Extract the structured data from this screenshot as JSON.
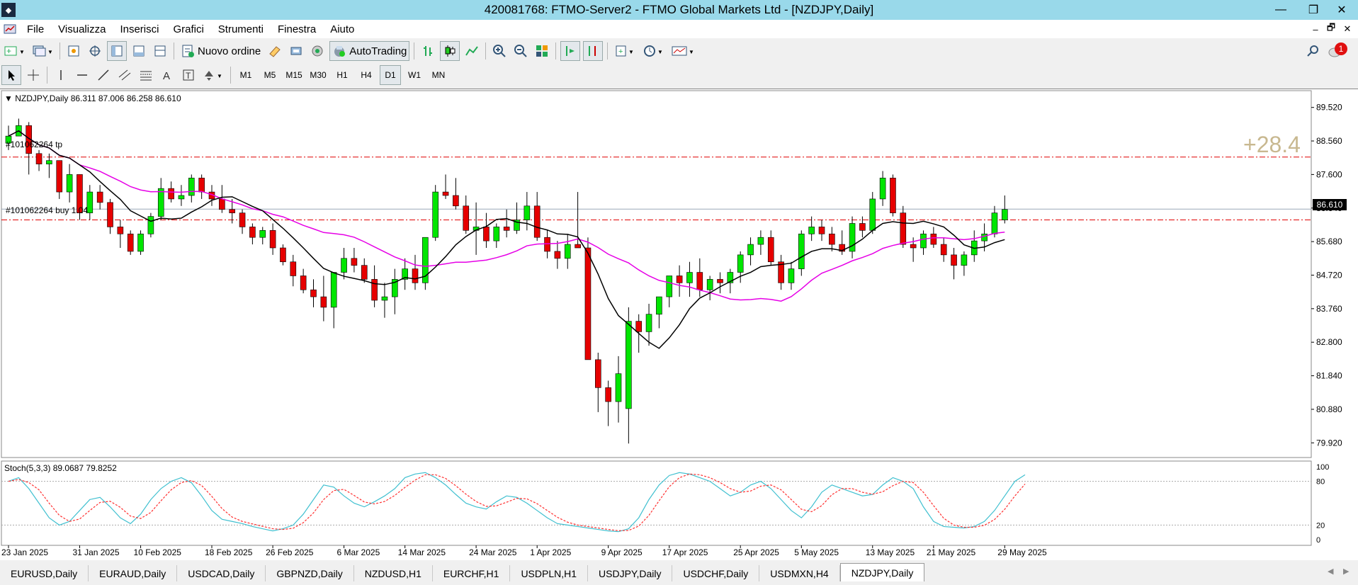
{
  "window": {
    "title": "420081768: FTMO-Server2 - FTMO Global Markets Ltd - [NZDJPY,Daily]",
    "app_icon": "◆",
    "minimize": "—",
    "restore": "❐",
    "close": "✕"
  },
  "menu": [
    "File",
    "Visualizza",
    "Inserisci",
    "Grafici",
    "Strumenti",
    "Finestra",
    "Aiuto"
  ],
  "mdi": {
    "minimize": "–",
    "restore": "🗗",
    "close": "✕"
  },
  "toolbar": {
    "new_order": "Nuovo ordine",
    "autotrading": "AutoTrading",
    "notification_count": "1"
  },
  "timeframes": [
    "M1",
    "M5",
    "M15",
    "M30",
    "H1",
    "H4",
    "D1",
    "W1",
    "MN"
  ],
  "active_timeframe": "D1",
  "chart": {
    "header": "NZDJPY,Daily  86.311 87.006 86.258 86.610",
    "stoch_header": "Stoch(5,3,3) 89.0687 79.8252",
    "tp_label": "#101062264 tp",
    "buy_label": "#101062264 buy 1.04",
    "profit": "+28.4",
    "current_price": "86.610",
    "price_levels": [
      "89.520",
      "88.560",
      "87.600",
      "86.640",
      "85.680",
      "84.720",
      "83.760",
      "82.800",
      "81.840",
      "80.880",
      "79.920"
    ],
    "stoch_levels": [
      "100",
      "80",
      "20",
      "0"
    ],
    "dates": [
      "23 Jan 2025",
      "31 Jan 2025",
      "10 Feb 2025",
      "18 Feb 2025",
      "26 Feb 2025",
      "6 Mar 2025",
      "14 Mar 2025",
      "24 Mar 2025",
      "1 Apr 2025",
      "9 Apr 2025",
      "17 Apr 2025",
      "25 Apr 2025",
      "5 May 2025",
      "13 May 2025",
      "21 May 2025",
      "29 May 2025"
    ],
    "colors": {
      "bull": "#00e600",
      "bear": "#e60000",
      "ma_fast": "#000000",
      "ma_slow": "#e600e6",
      "stoch_main": "#40c0d0",
      "stoch_signal": "#ff3030",
      "profit": "#c8b890"
    }
  },
  "chart_data": {
    "type": "candlestick",
    "symbol": "NZDJPY",
    "timeframe": "Daily",
    "ylim": [
      79.5,
      90.0
    ],
    "tp_price": 88.1,
    "entry_price": 86.3,
    "current_price": 86.61,
    "candles": [
      [
        88.5,
        89.0,
        88.3,
        88.7
      ],
      [
        88.7,
        89.2,
        88.8,
        89.0
      ],
      [
        89.0,
        89.1,
        87.6,
        88.2
      ],
      [
        88.2,
        88.3,
        87.7,
        87.9
      ],
      [
        87.9,
        88.2,
        87.5,
        88.0
      ],
      [
        88.0,
        88.0,
        86.9,
        87.1
      ],
      [
        87.1,
        87.9,
        86.8,
        87.6
      ],
      [
        87.6,
        87.6,
        86.3,
        86.5
      ],
      [
        86.5,
        87.3,
        86.3,
        87.1
      ],
      [
        87.1,
        87.3,
        86.6,
        86.8
      ],
      [
        86.8,
        86.9,
        85.9,
        86.1
      ],
      [
        86.1,
        86.3,
        85.5,
        85.9
      ],
      [
        85.9,
        86.0,
        85.3,
        85.4
      ],
      [
        85.4,
        86.0,
        85.3,
        85.9
      ],
      [
        85.9,
        86.5,
        85.8,
        86.4
      ],
      [
        86.4,
        87.5,
        86.3,
        87.2
      ],
      [
        87.2,
        87.4,
        86.8,
        86.9
      ],
      [
        86.9,
        87.3,
        86.7,
        87.0
      ],
      [
        87.0,
        87.6,
        86.8,
        87.5
      ],
      [
        87.5,
        87.6,
        86.9,
        87.1
      ],
      [
        87.1,
        87.3,
        86.7,
        86.9
      ],
      [
        86.9,
        87.3,
        86.5,
        86.6
      ],
      [
        86.6,
        86.9,
        86.2,
        86.5
      ],
      [
        86.5,
        86.6,
        85.9,
        86.1
      ],
      [
        86.1,
        86.2,
        85.6,
        85.8
      ],
      [
        85.8,
        86.1,
        85.6,
        86.0
      ],
      [
        86.0,
        86.2,
        85.3,
        85.5
      ],
      [
        85.5,
        85.6,
        85.0,
        85.1
      ],
      [
        85.1,
        85.3,
        84.4,
        84.7
      ],
      [
        84.7,
        84.9,
        84.2,
        84.3
      ],
      [
        84.3,
        84.6,
        83.8,
        84.1
      ],
      [
        84.1,
        84.7,
        83.4,
        83.8
      ],
      [
        83.8,
        84.6,
        83.2,
        84.8
      ],
      [
        84.8,
        85.5,
        84.6,
        85.2
      ],
      [
        85.2,
        85.5,
        84.8,
        85.0
      ],
      [
        85.0,
        85.2,
        84.5,
        84.6
      ],
      [
        84.6,
        85.0,
        83.8,
        84.0
      ],
      [
        84.0,
        84.5,
        83.5,
        84.1
      ],
      [
        84.1,
        84.9,
        83.6,
        84.6
      ],
      [
        84.6,
        85.2,
        84.3,
        84.9
      ],
      [
        84.9,
        85.3,
        84.3,
        84.5
      ],
      [
        84.5,
        85.8,
        84.3,
        85.8
      ],
      [
        85.8,
        87.3,
        85.7,
        87.1
      ],
      [
        87.1,
        87.6,
        86.9,
        87.0
      ],
      [
        87.0,
        87.5,
        86.6,
        86.7
      ],
      [
        86.7,
        87.0,
        85.9,
        86.0
      ],
      [
        86.0,
        86.8,
        85.3,
        86.1
      ],
      [
        86.1,
        86.5,
        85.5,
        85.7
      ],
      [
        85.7,
        86.2,
        85.5,
        86.1
      ],
      [
        86.1,
        86.6,
        85.8,
        86.0
      ],
      [
        86.0,
        86.8,
        85.9,
        86.3
      ],
      [
        86.3,
        87.1,
        86.0,
        86.7
      ],
      [
        86.7,
        87.1,
        85.7,
        85.8
      ],
      [
        85.8,
        86.0,
        85.2,
        85.4
      ],
      [
        85.4,
        85.7,
        84.9,
        85.2
      ],
      [
        85.2,
        85.9,
        84.9,
        85.6
      ],
      [
        85.6,
        87.1,
        85.5,
        85.5
      ],
      [
        85.5,
        85.8,
        83.0,
        82.3
      ],
      [
        82.3,
        82.5,
        80.8,
        81.5
      ],
      [
        81.5,
        81.7,
        80.4,
        81.1
      ],
      [
        81.1,
        82.4,
        80.5,
        81.9
      ],
      [
        80.9,
        83.8,
        79.9,
        83.4
      ],
      [
        83.4,
        83.6,
        82.5,
        83.1
      ],
      [
        83.1,
        83.9,
        82.7,
        83.6
      ],
      [
        83.6,
        84.1,
        83.2,
        84.1
      ],
      [
        84.1,
        84.7,
        83.8,
        84.7
      ],
      [
        84.7,
        85.0,
        84.1,
        84.5
      ],
      [
        84.5,
        85.1,
        84.1,
        84.8
      ],
      [
        84.8,
        85.2,
        84.1,
        84.3
      ],
      [
        84.3,
        84.7,
        84.0,
        84.6
      ],
      [
        84.6,
        84.8,
        84.2,
        84.5
      ],
      [
        84.5,
        84.9,
        84.2,
        84.8
      ],
      [
        84.8,
        85.4,
        84.5,
        85.3
      ],
      [
        85.3,
        85.8,
        85.0,
        85.6
      ],
      [
        85.6,
        86.0,
        85.3,
        85.8
      ],
      [
        85.8,
        86.0,
        85.0,
        85.1
      ],
      [
        85.1,
        85.3,
        84.3,
        84.5
      ],
      [
        84.5,
        85.1,
        84.3,
        84.9
      ],
      [
        84.9,
        86.0,
        84.7,
        85.9
      ],
      [
        85.9,
        86.4,
        85.7,
        86.1
      ],
      [
        86.1,
        86.3,
        85.7,
        85.9
      ],
      [
        85.9,
        86.1,
        85.4,
        85.6
      ],
      [
        85.6,
        86.0,
        85.3,
        85.4
      ],
      [
        85.4,
        86.4,
        85.2,
        86.2
      ],
      [
        86.2,
        86.4,
        85.8,
        86.0
      ],
      [
        86.0,
        87.1,
        85.9,
        86.9
      ],
      [
        86.9,
        87.7,
        86.7,
        87.5
      ],
      [
        87.5,
        87.6,
        86.4,
        86.5
      ],
      [
        86.5,
        86.7,
        85.5,
        85.6
      ],
      [
        85.6,
        85.8,
        85.1,
        85.5
      ],
      [
        85.5,
        86.0,
        85.3,
        85.9
      ],
      [
        85.9,
        86.1,
        85.5,
        85.6
      ],
      [
        85.6,
        85.8,
        85.1,
        85.3
      ],
      [
        85.3,
        85.5,
        84.6,
        85.0
      ],
      [
        85.0,
        85.4,
        84.7,
        85.3
      ],
      [
        85.3,
        86.0,
        85.1,
        85.7
      ],
      [
        85.7,
        86.2,
        85.4,
        85.9
      ],
      [
        85.9,
        86.7,
        85.8,
        86.5
      ],
      [
        86.3,
        87.0,
        86.2,
        86.6
      ]
    ],
    "stochastic_main": [
      80,
      85,
      70,
      50,
      30,
      20,
      25,
      40,
      55,
      58,
      45,
      30,
      22,
      35,
      55,
      70,
      80,
      85,
      78,
      60,
      40,
      28,
      25,
      22,
      18,
      15,
      12,
      15,
      20,
      35,
      55,
      75,
      72,
      60,
      50,
      45,
      52,
      60,
      70,
      85,
      90,
      92,
      85,
      75,
      62,
      50,
      45,
      42,
      52,
      60,
      58,
      50,
      40,
      30,
      22,
      20,
      18,
      16,
      14,
      12,
      11,
      15,
      30,
      55,
      75,
      88,
      92,
      90,
      85,
      80,
      70,
      60,
      65,
      75,
      80,
      70,
      55,
      40,
      30,
      45,
      65,
      75,
      70,
      65,
      60,
      62,
      75,
      85,
      80,
      70,
      45,
      25,
      18,
      17,
      16,
      18,
      25,
      40,
      60,
      80,
      89
    ]
  }
}
